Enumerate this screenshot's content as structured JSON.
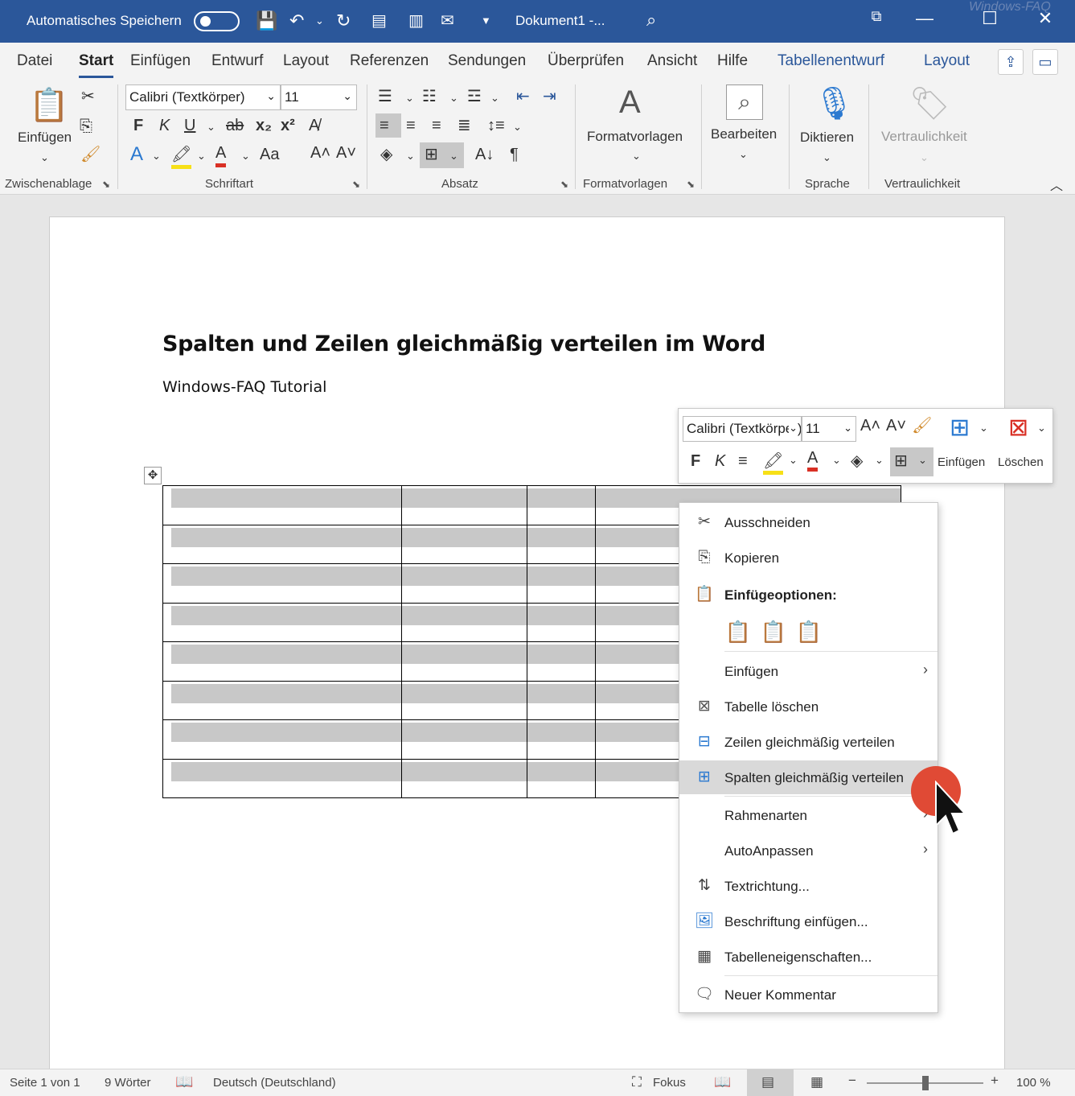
{
  "titlebar": {
    "autosave": "Automatisches Speichern",
    "doc_title": "Dokument1  -...",
    "watermark": "Windows-FAQ"
  },
  "tabs": [
    "Datei",
    "Start",
    "Einfügen",
    "Entwurf",
    "Layout",
    "Referenzen",
    "Sendungen",
    "Überprüfen",
    "Ansicht",
    "Hilfe",
    "Tabellenentwurf",
    "Layout"
  ],
  "ribbon": {
    "paste_label": "Einfügen",
    "font_name": "Calibri (Textkörper)",
    "font_size": "11",
    "styles_label": "Formatvorlagen",
    "edit_label": "Bearbeiten",
    "dictate_label": "Diktieren",
    "sensitivity_label": "Vertraulichkeit",
    "groups": {
      "clipboard": "Zwischenablage",
      "font": "Schriftart",
      "paragraph": "Absatz",
      "styles": "Formatvorlagen",
      "voice": "Sprache",
      "sensitivity": "Vertraulichkeit"
    },
    "bold": "F",
    "italic": "K",
    "underline": "U",
    "strike": "ab",
    "subscript": "x₂",
    "superscript": "x²",
    "font_case": "Aa"
  },
  "document": {
    "title": "Spalten und Zeilen gleichmäßig verteilen im Word",
    "subtitle": "Windows-FAQ Tutorial"
  },
  "minibar": {
    "font_name": "Calibri (Textkörper)",
    "font_size": "11",
    "bold": "F",
    "italic": "K",
    "insert_label": "Einfügen",
    "delete_label": "Löschen"
  },
  "context_menu": {
    "cut": "Ausschneiden",
    "copy": "Kopieren",
    "paste_options": "Einfügeoptionen:",
    "insert": "Einfügen",
    "delete_table": "Tabelle löschen",
    "distribute_rows": "Zeilen gleichmäßig verteilen",
    "distribute_columns": "Spalten gleichmäßig verteilen",
    "borders": "Rahmenarten",
    "autofit": "AutoAnpassen",
    "text_direction": "Textrichtung...",
    "insert_caption": "Beschriftung einfügen...",
    "table_properties": "Tabelleneigenschaften...",
    "new_comment": "Neuer Kommentar"
  },
  "statusbar": {
    "page": "Seite 1 von 1",
    "words": "9 Wörter",
    "language": "Deutsch (Deutschland)",
    "focus": "Fokus",
    "zoom": "100 %"
  },
  "colors": {
    "accent": "#2b579a",
    "click_marker": "#e04a35",
    "hover": "#d9d9d9"
  }
}
